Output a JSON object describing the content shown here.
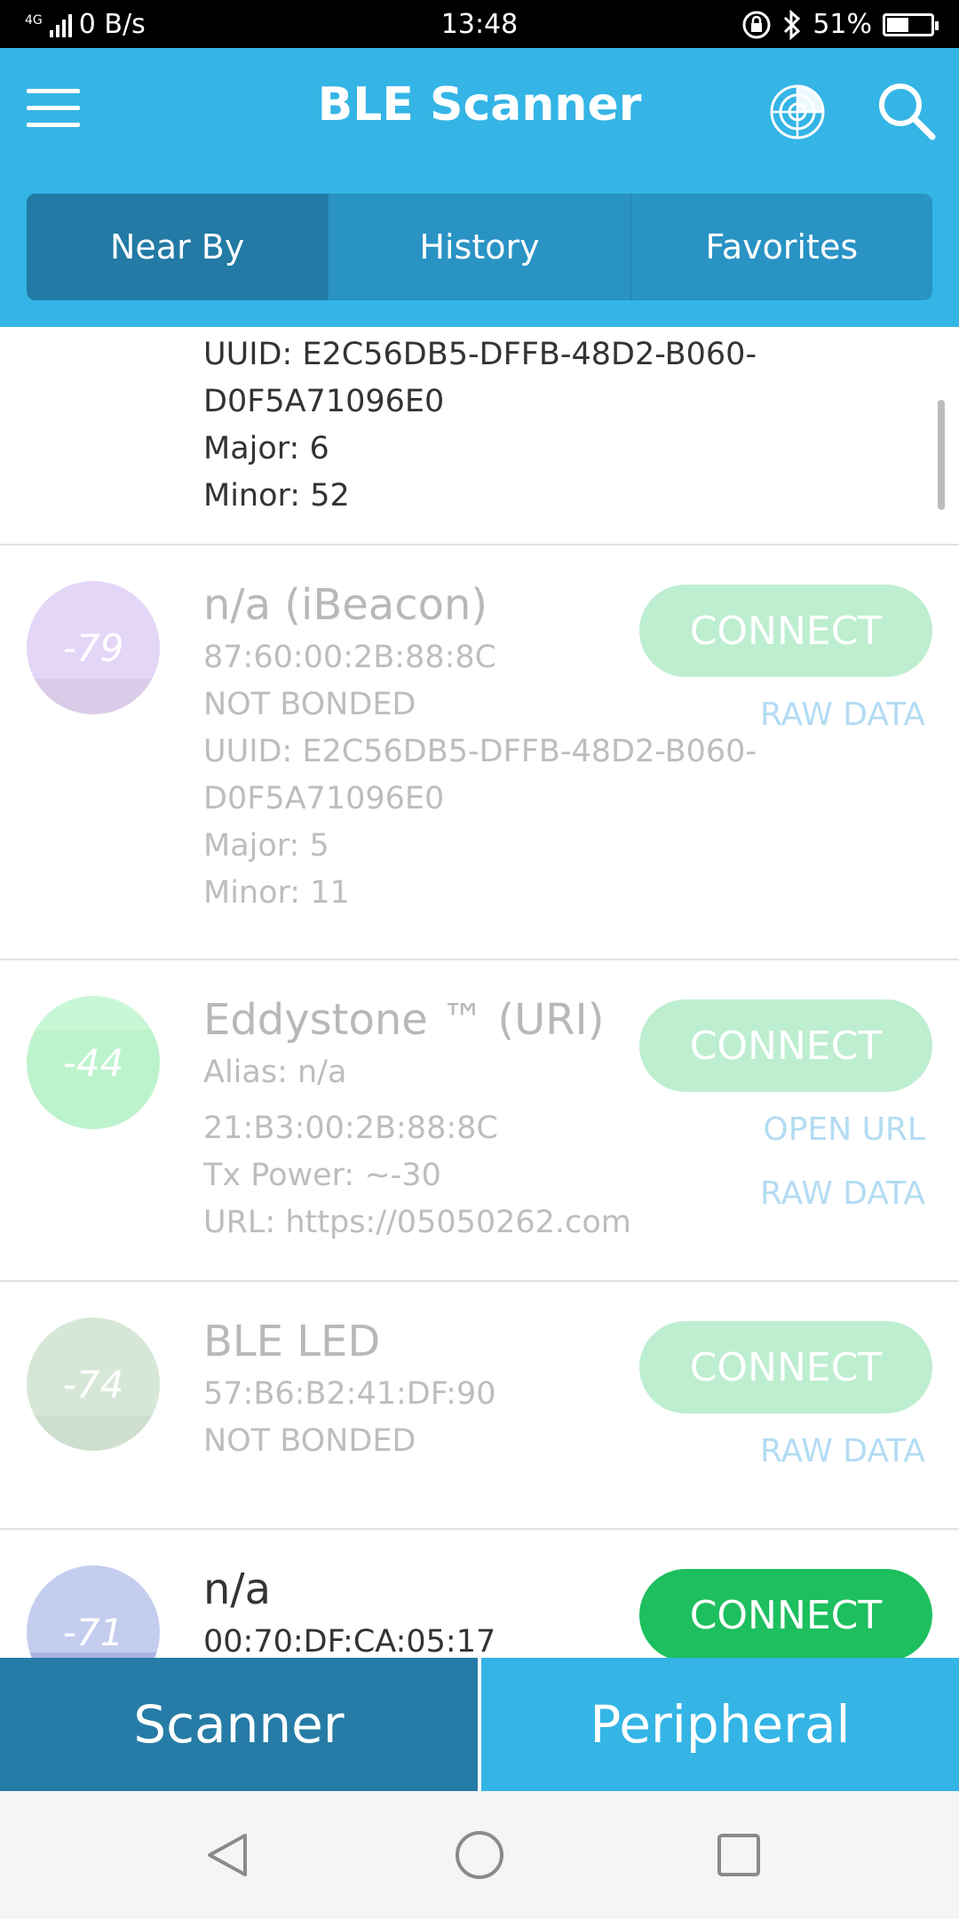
{
  "status_bar": {
    "network": "4G",
    "speed": "0 B/s",
    "time": "13:48",
    "battery": "51%",
    "battery_level": 0.51
  },
  "app": {
    "title": "BLE Scanner"
  },
  "tabs": [
    {
      "label": "Near By",
      "active": true
    },
    {
      "label": "History",
      "active": false
    },
    {
      "label": "Favorites",
      "active": false
    }
  ],
  "top_partial": {
    "uuid1": "UUID: E2C56DB5-DFFB-48D2-B060-",
    "uuid2": "D0F5A71096E0",
    "major": "Major: 6",
    "minor": "Minor: 52"
  },
  "devices": [
    {
      "rssi": "-79",
      "color": "#e4d6f7",
      "band": "#dacbe8",
      "name": "n/a (iBeacon)",
      "mac": "87:60:00:2B:88:8C",
      "bond": "NOT BONDED",
      "uuid1": "UUID: E2C56DB5-DFFB-48D2-B060-",
      "uuid2": "D0F5A71096E0",
      "major": "Major: 5",
      "minor": "Minor: 11",
      "connect": "CONNECT",
      "raw": "RAW DATA"
    },
    {
      "rssi": "-44",
      "color": "#bdf3cc",
      "band": "#c8f7d6",
      "name": "Eddystone ™ (URI)",
      "alias": "Alias: n/a",
      "mac": "21:B3:00:2B:88:8C",
      "tx": "Tx Power: ~-30",
      "url": "URL: https://05050262.com",
      "connect": "CONNECT",
      "open_url": "OPEN URL",
      "raw": "RAW DATA"
    },
    {
      "rssi": "-74",
      "color": "#d7e7d7",
      "band": "#cfdfcf",
      "name": "BLE LED",
      "mac": "57:B6:B2:41:DF:90",
      "bond": "NOT BONDED",
      "connect": "CONNECT",
      "raw": "RAW DATA"
    },
    {
      "rssi": "-71",
      "color": "#c5cdee",
      "band": "#a9b4e0",
      "name": "n/a",
      "mac": "00:70:DF:CA:05:17",
      "connect": "CONNECT"
    }
  ],
  "bottom_tabs": {
    "scanner": "Scanner",
    "peripheral": "Peripheral"
  },
  "colors": {
    "primary": "#34b5e5",
    "primary_dark": "#267ca6",
    "connect_green": "#1dbf5e"
  },
  "icons": [
    "menu-icon",
    "radar-icon",
    "search-icon",
    "back-icon",
    "home-icon",
    "recents-icon"
  ]
}
